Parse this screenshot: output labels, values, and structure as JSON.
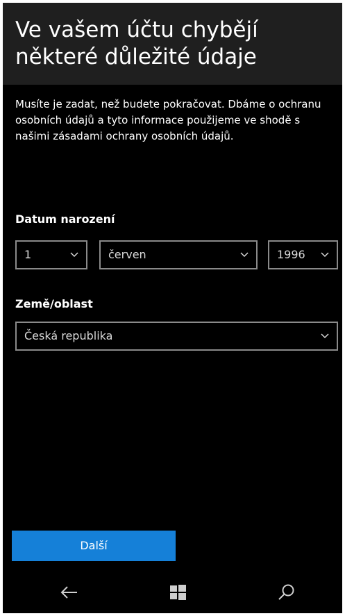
{
  "header": {
    "title": "Ve vašem účtu chybějí některé důležité údaje"
  },
  "intro": {
    "text": "Musíte je zadat, než budete pokračovat. Dbáme o ochranu osobních údajů a tyto informace použijeme ve shodě s našimi zásadami ochrany osobních údajů."
  },
  "birth_date": {
    "label": "Datum narození",
    "day": "1",
    "month": "červen",
    "year": "1996"
  },
  "country": {
    "label": "Země/oblast",
    "value": "Česká republika"
  },
  "next_button": {
    "label": "Další",
    "color": "#1580d8"
  },
  "navbar": {
    "icons": [
      "back-arrow-icon",
      "windows-logo-icon",
      "search-icon"
    ]
  },
  "colors": {
    "background": "#000000",
    "header_background": "#1f1f1f",
    "text": "#ffffff",
    "field_border": "#8a8a8a"
  }
}
